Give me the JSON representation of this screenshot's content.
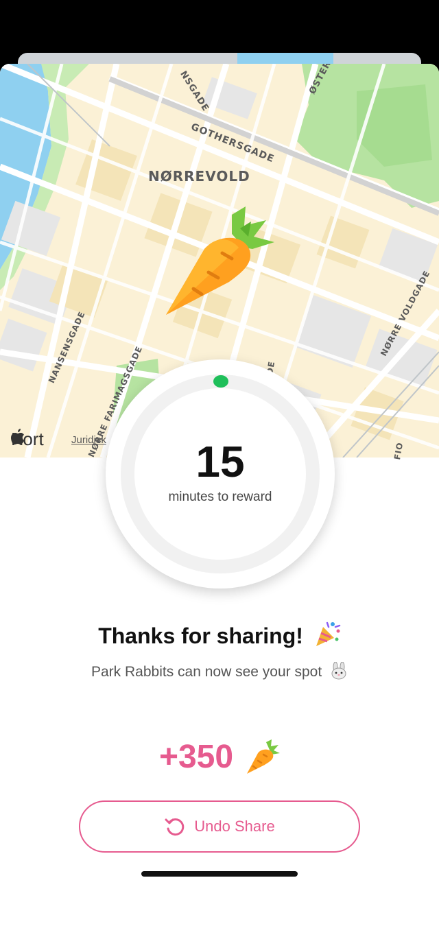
{
  "map": {
    "labels": {
      "district": "NØRREVOLD",
      "gothersgade": "GOTHERSGADE",
      "nansensgade": "NANSENSGADE",
      "farimagsgade": "NØRRE FARIMAGSGADE",
      "voldgade": "NØRRE VOLDGADE",
      "top_street": "NSGADE",
      "oster": "ØSTER",
      "fio": "FIO",
      "de": "DE"
    },
    "brand": "Kort",
    "legal": "Juridisk",
    "marker_icon": "carrot-icon"
  },
  "timer": {
    "value": "15",
    "caption": "minutes to reward",
    "accent": "#1fbf5a"
  },
  "message": {
    "title": "Thanks for sharing!",
    "title_emoji": "party-popper-icon",
    "subtitle": "Park Rabbits can now see your spot",
    "subtitle_emoji": "rabbit-icon"
  },
  "reward": {
    "amount": "+350",
    "icon": "carrot-icon",
    "color": "#e65b8f"
  },
  "undo": {
    "label": "Undo Share",
    "icon": "undo-icon"
  }
}
